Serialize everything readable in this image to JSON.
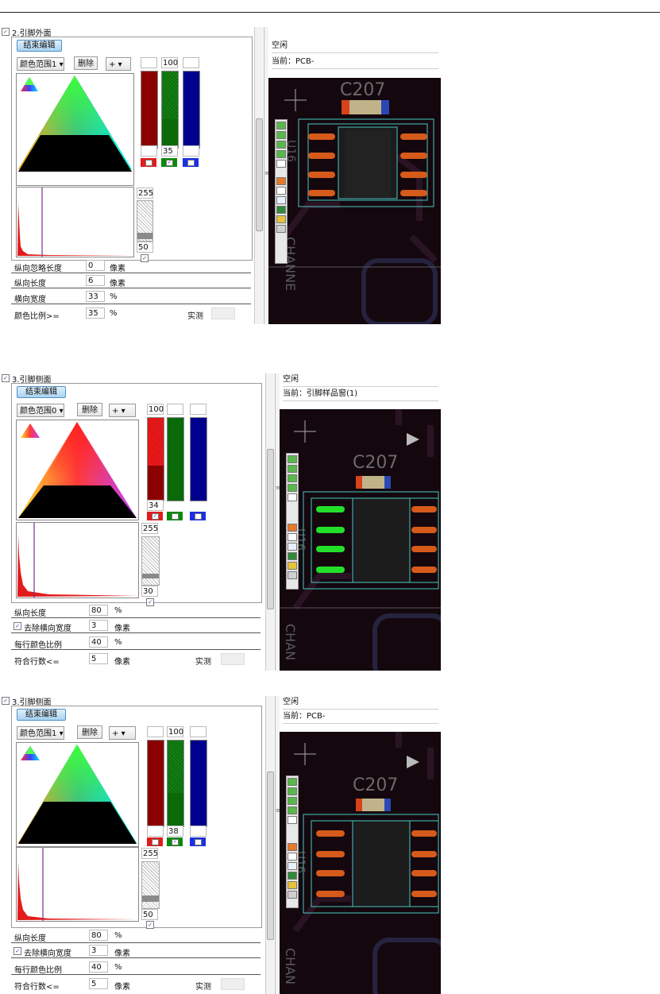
{
  "panels": [
    {
      "id": "p1",
      "section_title": "2.引脚外面",
      "end_edit_label": "结束编辑",
      "color_range": "颜色范围1",
      "delete_label": "删除",
      "plus_label": "+",
      "channel_value": "35",
      "top_value": "100",
      "channels_checked": [
        "",
        "✓",
        ""
      ],
      "hist_max": "255",
      "hist_min": "50",
      "hist_check": "✓",
      "rows": [
        {
          "label": "纵向忽略长度",
          "value": "0",
          "unit": "像素"
        },
        {
          "label": "纵向长度",
          "value": "6",
          "unit": "像素"
        },
        {
          "label": "横向宽度",
          "value": "33",
          "unit": "%"
        },
        {
          "label": "颜色比例>=",
          "value": "35",
          "unit": "%",
          "measure": "实测"
        }
      ],
      "status": "空闲",
      "current": "当前：PCB-",
      "pcb_label": "C207",
      "pcb_side": "U16",
      "pcb_bottom": "CHANNE"
    },
    {
      "id": "p2",
      "section_title": "3.引脚侧面",
      "end_edit_label": "结束编辑",
      "color_range": "颜色范围0",
      "delete_label": "删除",
      "plus_label": "+",
      "channel_value": "34",
      "top_value": "100",
      "channels_checked": [
        "✓",
        "",
        ""
      ],
      "hist_max": "255",
      "hist_min": "30",
      "hist_check": "✓",
      "rows": [
        {
          "label": "纵向长度",
          "value": "80",
          "unit": "%"
        },
        {
          "label": "去除横向宽度",
          "value": "3",
          "unit": "像素",
          "check": "✓"
        },
        {
          "label": "每行颜色比例",
          "value": "40",
          "unit": "%"
        },
        {
          "label": "符合行数<=",
          "value": "5",
          "unit": "像素",
          "measure": "实测"
        }
      ],
      "status": "空闲",
      "current": "当前：引脚样品窗(1)",
      "pcb_label": "C207",
      "pcb_side": "U16",
      "pcb_bottom": "CHAN"
    },
    {
      "id": "p3",
      "section_title": "3.引脚侧面",
      "end_edit_label": "结束编辑",
      "color_range": "颜色范围1",
      "delete_label": "删除",
      "plus_label": "+",
      "channel_value": "38",
      "top_value": "100",
      "channels_checked": [
        "",
        "✓",
        ""
      ],
      "hist_max": "255",
      "hist_min": "50",
      "hist_check": "✓",
      "rows": [
        {
          "label": "纵向长度",
          "value": "80",
          "unit": "%"
        },
        {
          "label": "去除横向宽度",
          "value": "3",
          "unit": "像素",
          "check": "✓"
        },
        {
          "label": "每行颜色比例",
          "value": "40",
          "unit": "%"
        },
        {
          "label": "符合行数<=",
          "value": "5",
          "unit": "像素",
          "measure": "实测"
        }
      ],
      "status": "空闲",
      "current": "当前：PCB-",
      "pcb_label": "C207",
      "pcb_side": "U16",
      "pcb_bottom": "CHAN"
    }
  ],
  "colors": {
    "red": "#8b0000",
    "red_active": "#ee1a1a",
    "green": "#0a6a0a",
    "blue": "#00008e",
    "pcb_bg": "#14080e",
    "pcb_outline": "#49c7c2",
    "pad": "#d65a1a"
  }
}
